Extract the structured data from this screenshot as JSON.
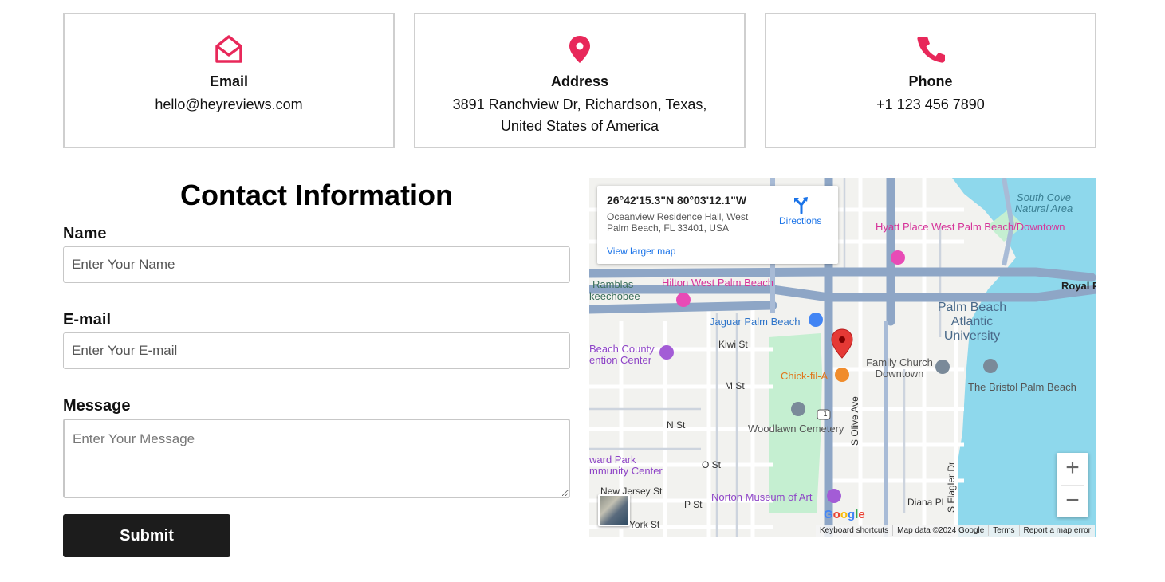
{
  "cards": [
    {
      "title": "Email",
      "value": "hello@heyreviews.com",
      "icon": "envelope-open-icon"
    },
    {
      "title": "Address",
      "value": "3891 Ranchview Dr, Richardson, Texas, United States of America",
      "icon": "map-pin-icon"
    },
    {
      "title": "Phone",
      "value": "+1 123 456 7890",
      "icon": "phone-icon"
    }
  ],
  "form": {
    "title": "Contact Information",
    "name_label": "Name",
    "name_placeholder": "Enter Your Name",
    "email_label": "E-mail",
    "email_placeholder": "Enter Your E-mail",
    "message_label": "Message",
    "message_placeholder": "Enter Your Message",
    "submit_label": "Submit"
  },
  "map": {
    "infobox": {
      "coords": "26°42'15.3\"N 80°03'12.1\"W",
      "address": "Oceanview Residence Hall, West Palm Beach, FL 33401, USA",
      "view_larger": "View larger map",
      "directions": "Directions"
    },
    "pois": {
      "hyatt": "Hyatt Place West Palm Beach/Downtown",
      "hilton": "Hilton West Palm Beach",
      "jaguar": "Jaguar Palm Beach",
      "convention": "Beach County ention Center",
      "chickfila": "Chick-fil-A",
      "church": "Family Church Downtown",
      "bristol": "The Bristol Palm Beach",
      "cemetery": "Woodlawn Cemetery",
      "howard": "ward Park mmunity Center",
      "norton": "Norton Museum of Art",
      "pba": "Palm Beach Atlantic University",
      "southcove": "South Cove Natural Area",
      "ramblas": "Ramblas",
      "okeechobee": "keechobee",
      "royal": "Royal P"
    },
    "streets": {
      "kiwi": "Kiwi St",
      "m": "M St",
      "n": "N St",
      "o": "O St",
      "p": "P St",
      "newjersey": "New Jersey St",
      "york": "York St",
      "diana": "Diana Pl",
      "olive": "S Olive Ave",
      "flagler": "S Flagler Dr",
      "route1": "1"
    },
    "zoom_in": "+",
    "zoom_out": "−",
    "google": "Google",
    "footer": {
      "shortcuts": "Keyboard shortcuts",
      "data": "Map data ©2024 Google",
      "terms": "Terms",
      "report": "Report a map error"
    }
  }
}
